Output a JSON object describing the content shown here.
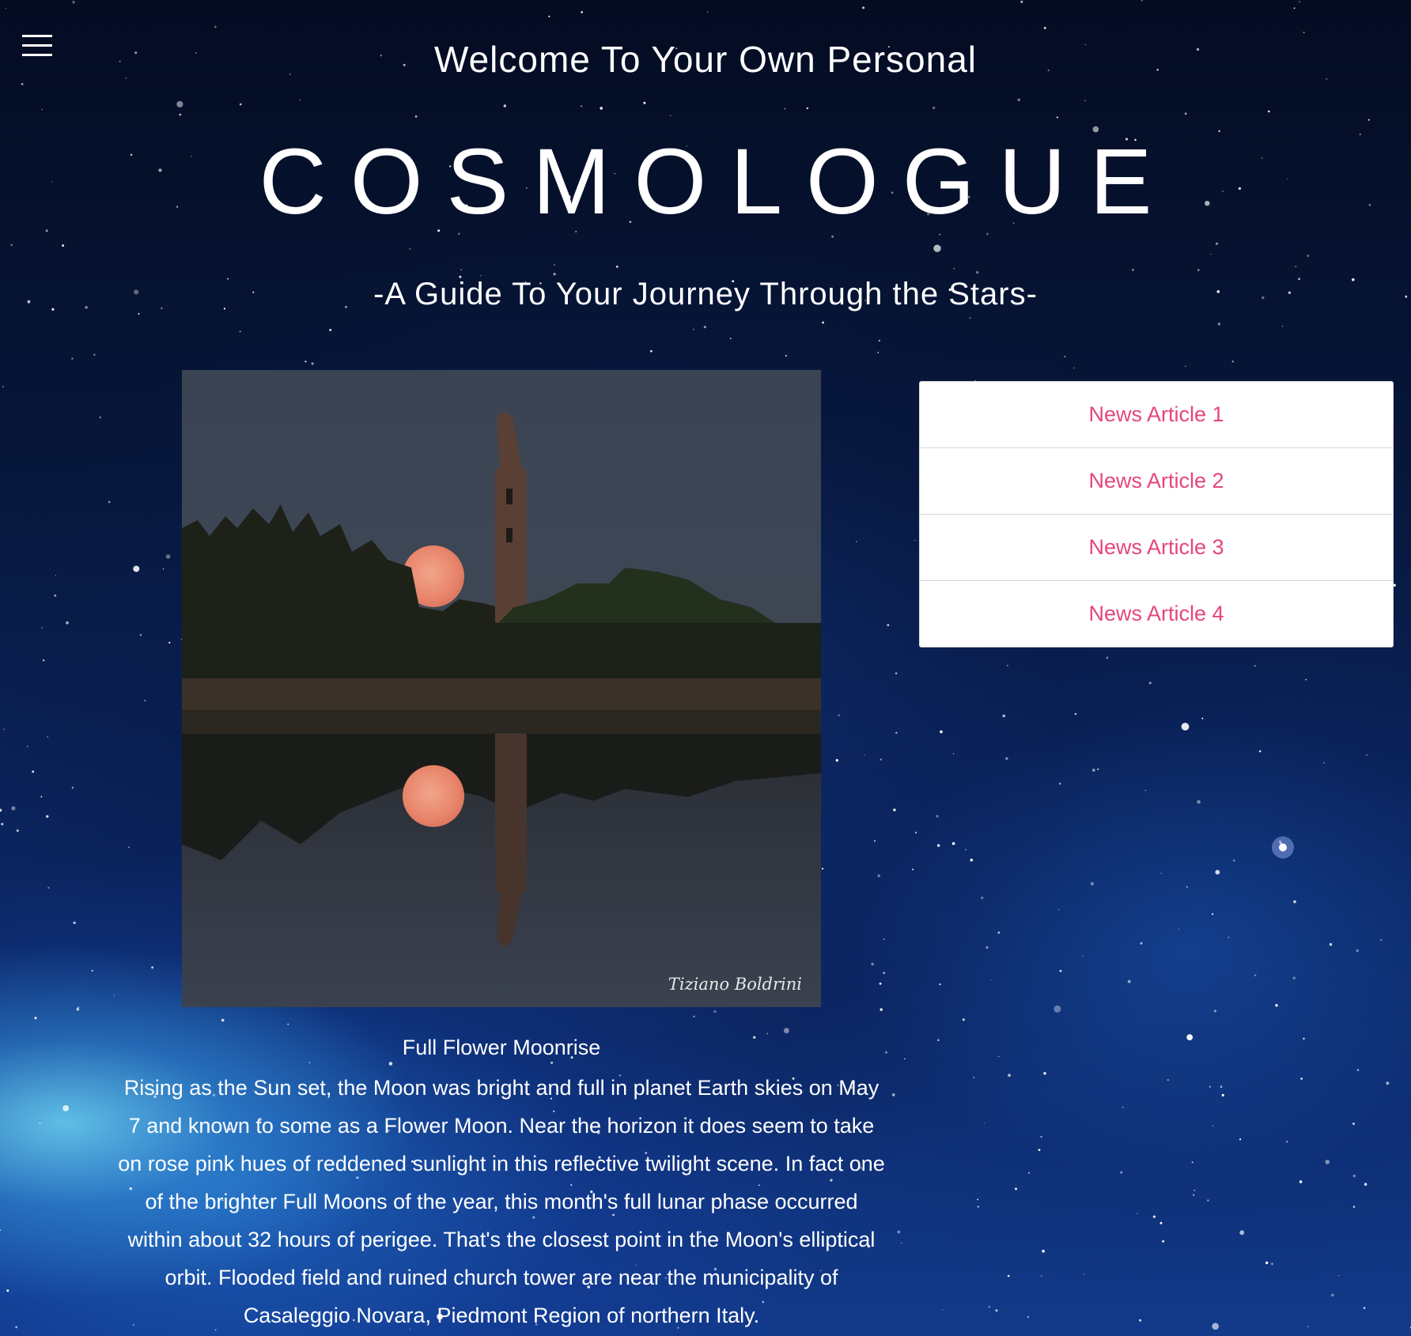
{
  "header": {
    "menu_icon": "hamburger-menu-icon",
    "welcome": "Welcome To Your Own Personal",
    "brand": "COSMOLOGUE",
    "tagline": "-A Guide To Your Journey Through the Stars-"
  },
  "featured": {
    "photo_credit": "Tiziano Boldrini",
    "title": "Full Flower Moonrise",
    "body": "Rising as the Sun set, the Moon was bright and full in planet Earth skies on May 7 and known to some as a Flower Moon. Near the horizon it does seem to take on rose pink hues of reddened sunlight in this reflective twilight scene. In fact one of the brighter Full Moons of the year, this month's full lunar phase occurred within about 32 hours of perigee. That's the closest point in the Moon's elliptical orbit. Flooded field and ruined church tower are near the municipality of Casaleggio Novara, Piedmont Region of northern Italy."
  },
  "news": {
    "items": [
      {
        "label": "News Article 1"
      },
      {
        "label": "News Article 2"
      },
      {
        "label": "News Article 3"
      },
      {
        "label": "News Article 4"
      }
    ]
  },
  "colors": {
    "link": "#e5457f",
    "background": "#07173b"
  }
}
